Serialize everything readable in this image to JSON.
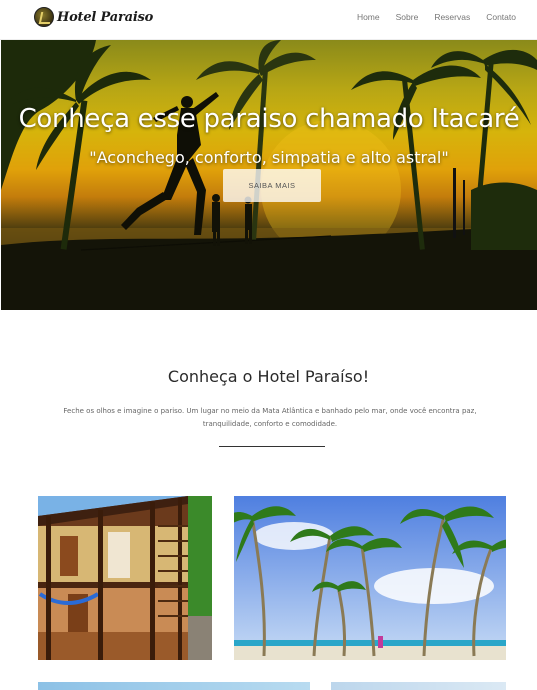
{
  "brand": {
    "name": "Hotel Paraiso",
    "logo_icon": "hotel-logo-mark"
  },
  "nav": {
    "items": [
      "Home",
      "Sobre",
      "Reservas",
      "Contato"
    ]
  },
  "hero": {
    "title": "Conheça esse paraiso chamado Itacaré",
    "subtitle": "\"Aconchego, conforto, simpatia e alto astral\"",
    "button": "SAIBA MAIS"
  },
  "intro": {
    "title": "Conheça o Hotel Paraíso!",
    "text": "Feche os olhos e imagine o pariso. Um lugar no meio da Mata Atlântica e banhado pelo mar, onde você encontra paz, tranquilidade, conforto e comodidade."
  },
  "colors": {
    "accent": "#333333",
    "nav_text": "#777777",
    "hero_gold": "#d6b40b"
  }
}
